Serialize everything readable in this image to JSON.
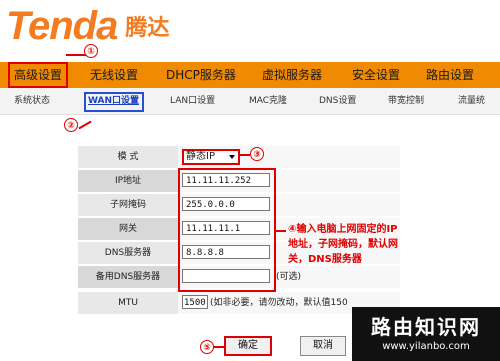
{
  "brand": {
    "name": "Tenda",
    "name_cn": "腾达"
  },
  "nav": {
    "items": [
      "高级设置",
      "无线设置",
      "DHCP服务器",
      "虚拟服务器",
      "安全设置",
      "路由设置"
    ]
  },
  "subnav": {
    "items": [
      "系统状态",
      "WAN口设置",
      "LAN口设置",
      "MAC克隆",
      "DNS设置",
      "带宽控制",
      "流量统"
    ]
  },
  "annotations": {
    "step1": "①",
    "step2": "②",
    "step3": "③",
    "step4": "④",
    "step5": "⑤",
    "note": "④输入电脑上网固定的IP地址，子网掩码，默认网关，DNS服务器"
  },
  "form": {
    "mode_label": "模    式",
    "mode_value": "静态IP",
    "ip_label": "IP地址",
    "ip_value": "11.11.11.252",
    "mask_label": "子网掩码",
    "mask_value": "255.0.0.0",
    "gateway_label": "网关",
    "gateway_value": "11.11.11.1",
    "dns_label": "DNS服务器",
    "dns_value": "8.8.8.8",
    "dns2_label": "备用DNS服务器",
    "dns2_value": "",
    "dns2_hint": "(可选)",
    "mtu_label": "MTU",
    "mtu_value": "1500",
    "mtu_hint": "(如非必要，请勿改动，默认值150"
  },
  "buttons": {
    "ok": "确定",
    "cancel": "取消"
  },
  "watermark": {
    "title": "路由知识网",
    "url": "www.yilanbo.com"
  },
  "colors": {
    "brand_orange": "#f47b20",
    "nav_bg": "#f08a00",
    "annotation_red": "#e00000",
    "active_blue": "#1a3fbf"
  }
}
